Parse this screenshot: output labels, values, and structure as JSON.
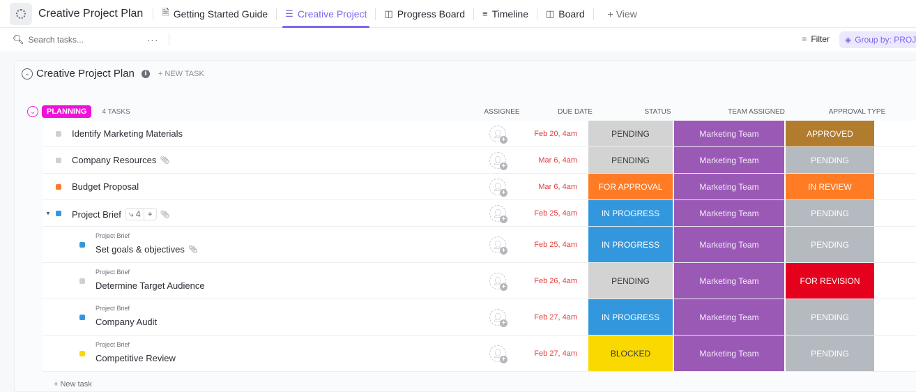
{
  "topbar": {
    "project_title": "Creative Project Plan",
    "tabs": [
      {
        "label": "Getting Started Guide",
        "icon": "doc-icon",
        "glyph": "🗎",
        "active": false
      },
      {
        "label": "Creative Project",
        "icon": "list-icon",
        "glyph": "☰",
        "active": true
      },
      {
        "label": "Progress Board",
        "icon": "board-icon",
        "glyph": "◫",
        "active": false
      },
      {
        "label": "Timeline",
        "icon": "timeline-icon",
        "glyph": "≡",
        "active": false
      },
      {
        "label": "Board",
        "icon": "board-icon",
        "glyph": "◫",
        "active": false
      }
    ],
    "add_view_label": "+ View"
  },
  "toolbar": {
    "search_placeholder": "Search tasks...",
    "more_label": "···",
    "filter_label": "Filter",
    "group_by_label": "Group by: PROJECT"
  },
  "list": {
    "title": "Creative Project Plan",
    "new_task_label": "+ NEW TASK",
    "new_task_bottom": "+ New task"
  },
  "group": {
    "name": "PLANNING",
    "color": "#ee11d7",
    "task_count": "4 TASKS"
  },
  "columns": {
    "assignee": "ASSIGNEE",
    "due_date": "DUE DATE",
    "status": "STATUS",
    "team": "TEAM ASSIGNED",
    "approval": "APPROVAL TYPE"
  },
  "colors": {
    "PENDING_status": "#d3d3d3",
    "FOR APPROVAL": "#ff7b24",
    "IN PROGRESS": "#3397dd",
    "BLOCKED": "#f9d900",
    "Marketing Team": "#9b59b6",
    "APPROVED": "#b27c2f",
    "PENDING_approval": "#b5b9c0",
    "IN REVIEW": "#ff7b24",
    "FOR REVISION": "#e5001e",
    "accent": "#7b68ee"
  },
  "tasks": [
    {
      "name": "Identify Marketing Materials",
      "parent": "",
      "square": "#d0d0d0",
      "due": "Feb 20, 4am",
      "status": "PENDING",
      "status_bg": "#d3d3d3",
      "status_fg": "#3a3a3a",
      "team": "Marketing Team",
      "approval": "APPROVED",
      "approval_bg": "#b27c2f",
      "attachment": false,
      "subtasks": ""
    },
    {
      "name": "Company Resources",
      "parent": "",
      "square": "#d0d0d0",
      "due": "Mar 6, 4am",
      "status": "PENDING",
      "status_bg": "#d3d3d3",
      "status_fg": "#3a3a3a",
      "team": "Marketing Team",
      "approval": "PENDING",
      "approval_bg": "#b5b9c0",
      "attachment": true,
      "subtasks": ""
    },
    {
      "name": "Budget Proposal",
      "parent": "",
      "square": "#ff7b24",
      "due": "Mar 6, 4am",
      "status": "FOR APPROVAL",
      "status_bg": "#ff7b24",
      "status_fg": "#ffffff",
      "team": "Marketing Team",
      "approval": "IN REVIEW",
      "approval_bg": "#ff7b24",
      "attachment": false,
      "subtasks": ""
    },
    {
      "name": "Project Brief",
      "parent": "",
      "square": "#3397dd",
      "due": "Feb 25, 4am",
      "status": "IN PROGRESS",
      "status_bg": "#3397dd",
      "status_fg": "#ffffff",
      "team": "Marketing Team",
      "approval": "PENDING",
      "approval_bg": "#b5b9c0",
      "attachment": true,
      "subtasks": "4",
      "expanded": true
    },
    {
      "name": "Set goals & objectives",
      "parent": "Project Brief",
      "square": "#3397dd",
      "due": "Feb 25, 4am",
      "status": "IN PROGRESS",
      "status_bg": "#3397dd",
      "status_fg": "#ffffff",
      "team": "Marketing Team",
      "approval": "PENDING",
      "approval_bg": "#b5b9c0",
      "attachment": true,
      "subtasks": ""
    },
    {
      "name": "Determine Target Audience",
      "parent": "Project Brief",
      "square": "#d0d0d0",
      "due": "Feb 26, 4am",
      "status": "PENDING",
      "status_bg": "#d3d3d3",
      "status_fg": "#3a3a3a",
      "team": "Marketing Team",
      "approval": "FOR REVISION",
      "approval_bg": "#e5001e",
      "attachment": false,
      "subtasks": ""
    },
    {
      "name": "Company Audit",
      "parent": "Project Brief",
      "square": "#3397dd",
      "due": "Feb 27, 4am",
      "status": "IN PROGRESS",
      "status_bg": "#3397dd",
      "status_fg": "#ffffff",
      "team": "Marketing Team",
      "approval": "PENDING",
      "approval_bg": "#b5b9c0",
      "attachment": false,
      "subtasks": ""
    },
    {
      "name": "Competitive Review",
      "parent": "Project Brief",
      "square": "#f9d900",
      "due": "Feb 27, 4am",
      "status": "BLOCKED",
      "status_bg": "#f9d900",
      "status_fg": "#3a3a3a",
      "team": "Marketing Team",
      "approval": "PENDING",
      "approval_bg": "#b5b9c0",
      "attachment": false,
      "subtasks": ""
    }
  ]
}
